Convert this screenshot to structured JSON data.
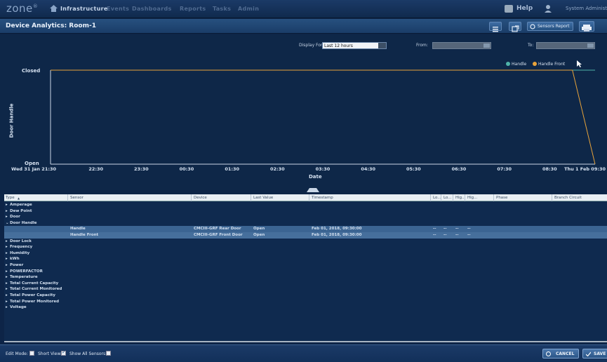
{
  "nav": {
    "logo": "zone",
    "items": [
      "Infrastructure",
      "Events",
      "Dashboards",
      "Reports",
      "Tasks",
      "Admin"
    ],
    "active": "Infrastructure",
    "help": "Help",
    "user": "System Administr"
  },
  "titlebar": {
    "title": "Device Analytics: Room-1",
    "sensors_button": "Sensors Report"
  },
  "filters": {
    "display_for_label": "Display For:",
    "display_for_value": "Last 12 hours",
    "from_label": "From:",
    "to_label": "To:"
  },
  "chart_data": {
    "type": "line",
    "ylabel": "Door Handle",
    "xlabel": "Date",
    "y_categories": [
      "Open",
      "Closed"
    ],
    "x_ticks": [
      "Wed 31 Jan 21:30",
      "22:30",
      "23:30",
      "00:30",
      "01:30",
      "02:30",
      "03:30",
      "04:30",
      "05:30",
      "06:30",
      "07:30",
      "08:30",
      "Thu 1 Feb 09:30"
    ],
    "series": [
      {
        "name": "Handle",
        "color": "#4fb3a9",
        "points": [
          [
            "Wed 31 Jan 21:30",
            "Closed"
          ],
          [
            "Thu 1 Feb 09:30",
            "Closed"
          ]
        ]
      },
      {
        "name": "Handle Front",
        "color": "#e8a33a",
        "points": [
          [
            "Wed 31 Jan 21:30",
            "Closed"
          ],
          [
            "Thu 1 Feb 09:00",
            "Closed"
          ],
          [
            "Thu 1 Feb 09:30",
            "Open"
          ]
        ]
      }
    ],
    "legend_position": "top-right",
    "grid": false
  },
  "grid": {
    "columns": [
      "Type",
      "Sensor",
      "Device",
      "Last Value",
      "Timestamp",
      "Lo...",
      "Lo...",
      "Hig...",
      "Hig...",
      "Phase",
      "Branch Circuit"
    ],
    "groups_before": [
      "Amperage",
      "Dew Point",
      "Door"
    ],
    "expanded_group": "Door Handle",
    "expanded_rows": [
      {
        "sensor": "Handle",
        "device": "CMCIII-GRF Rear Door",
        "value": "Open",
        "timestamp": "Feb 01, 2018, 09:30:00",
        "lo1": "--",
        "lo2": "--",
        "hi1": "--",
        "hi2": "--"
      },
      {
        "sensor": "Handle Front",
        "device": "CMCIII-GRF Front Door",
        "value": "Open",
        "timestamp": "Feb 01, 2018, 09:30:00",
        "lo1": "--",
        "lo2": "--",
        "hi1": "--",
        "hi2": "--"
      }
    ],
    "groups_after": [
      "Door Lock",
      "Frequency",
      "Humidity",
      "kWh",
      "Power",
      "POWERFACTOR",
      "Temperature",
      "Total Current Capacity",
      "Total Current Monitored",
      "Total Power Capacity",
      "Total Power Monitored",
      "Voltage"
    ]
  },
  "bottombar": {
    "edit_mode": "Edit Mode:",
    "short_view": "Short View:",
    "show_all": "Show All Sensors:",
    "cancel": "CANCEL",
    "save": "SAVE"
  },
  "colors": {
    "bg": "#0d2447",
    "handle": "#4fb3a9",
    "handle_front": "#e8a33a"
  }
}
